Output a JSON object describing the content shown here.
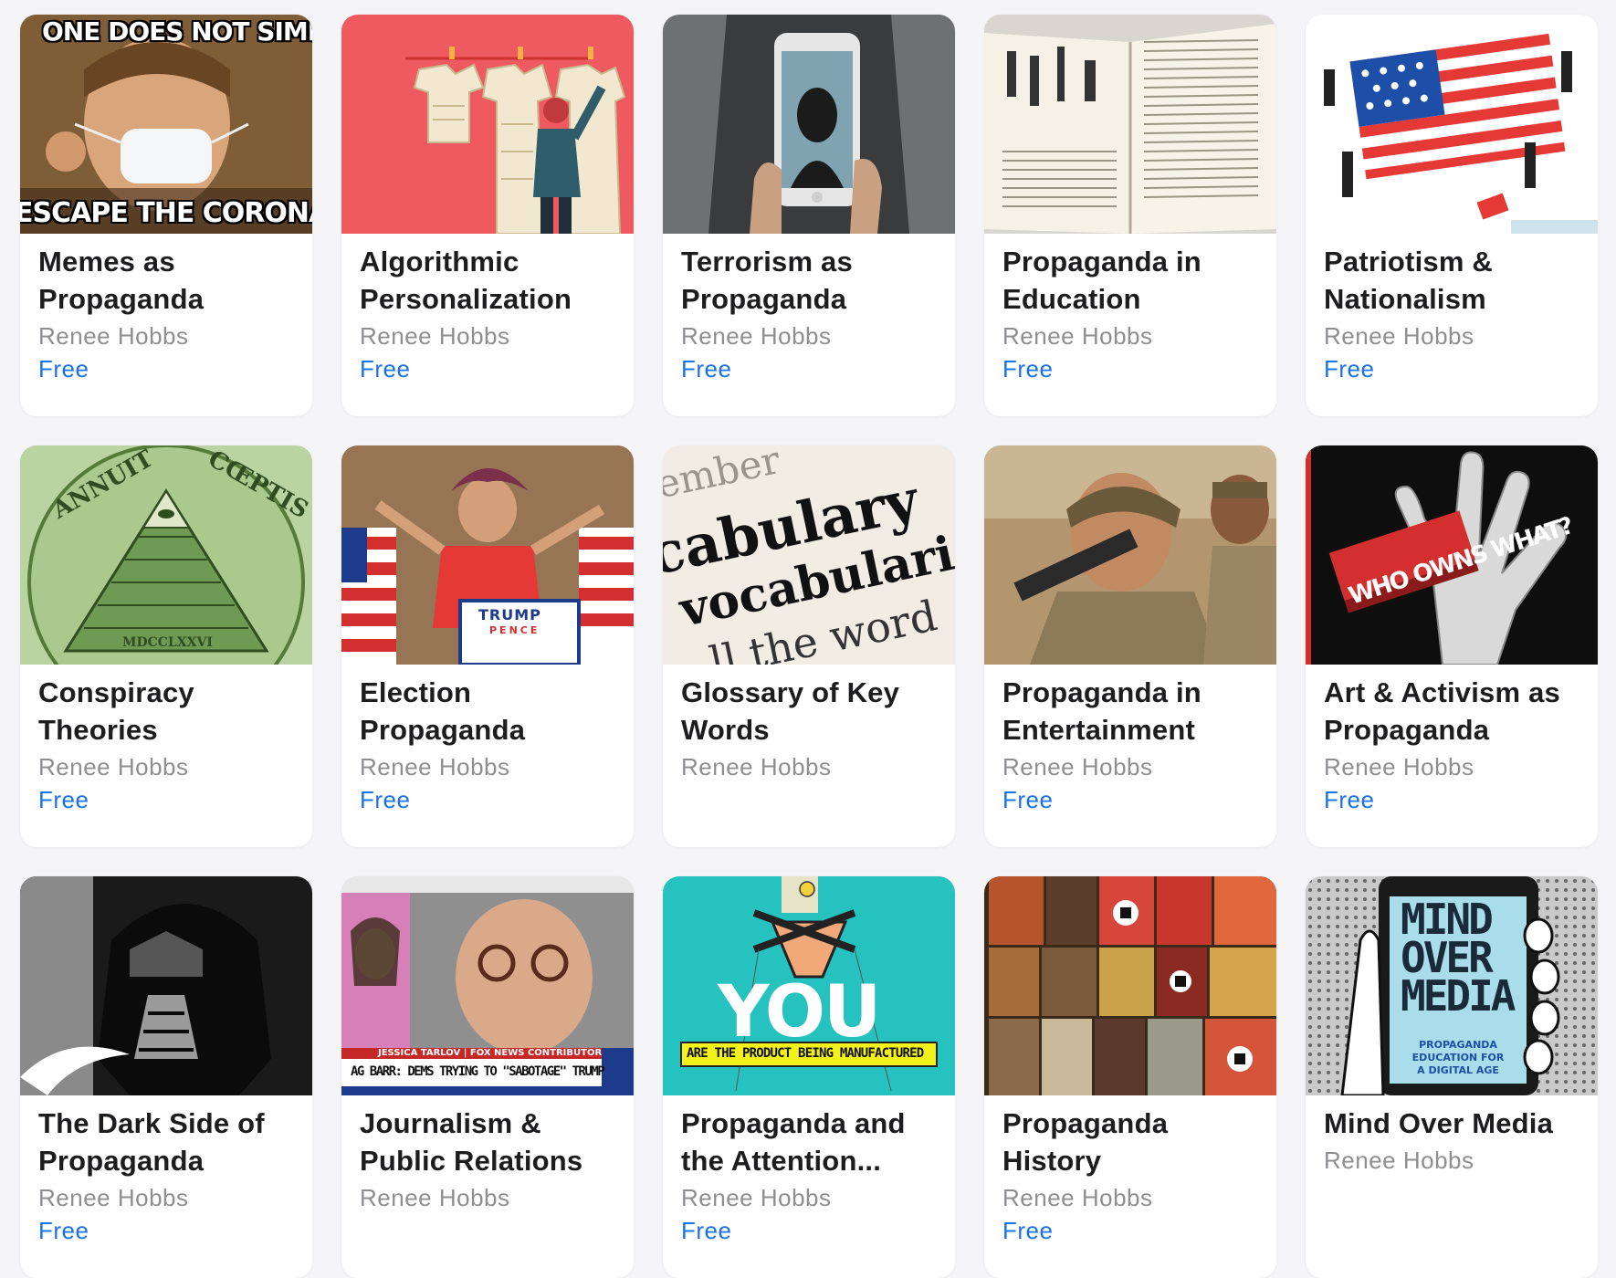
{
  "books": [
    {
      "title_line1": "Memes as",
      "title_line2": "Propaganda",
      "author": "Renee Hobbs",
      "price": "Free",
      "cover_top": "ONE DOES NOT SIMPLY",
      "cover_bottom": "ESCAPE THE CORONAVIRUS"
    },
    {
      "title_line1": "Algorithmic",
      "title_line2": "Personalization",
      "author": "Renee Hobbs",
      "price": "Free"
    },
    {
      "title_line1": "Terrorism as",
      "title_line2": "Propaganda",
      "author": "Renee Hobbs",
      "price": "Free"
    },
    {
      "title_line1": "Propaganda in",
      "title_line2": "Education",
      "author": "Renee Hobbs",
      "price": "Free"
    },
    {
      "title_line1": "Patriotism &",
      "title_line2": "Nationalism",
      "author": "Renee Hobbs",
      "price": "Free"
    },
    {
      "title_line1": "Conspiracy",
      "title_line2": "Theories",
      "author": "Renee Hobbs",
      "price": "Free",
      "cover_top_left": "ANNUIT",
      "cover_top_right": "CŒPTIS",
      "cover_bottom": "MDCCLXXVI"
    },
    {
      "title_line1": "Election",
      "title_line2": "Propaganda",
      "author": "Renee Hobbs",
      "price": "Free",
      "cover_sign1": "TRUMP",
      "cover_sign2": "PENCE"
    },
    {
      "title_line1": "Glossary of Key",
      "title_line2": "Words",
      "author": "Renee Hobbs",
      "price": "",
      "cover_l1": "iember",
      "cover_l2": "cabulary",
      "cover_l3": "vocabularie",
      "cover_l4": "ll the word"
    },
    {
      "title_line1": "Propaganda in",
      "title_line2": "Entertainment",
      "author": "Renee Hobbs",
      "price": "Free"
    },
    {
      "title_line1": "Art & Activism as",
      "title_line2": "Propaganda",
      "author": "Renee Hobbs",
      "price": "Free",
      "cover_sign": "WHO OWNS WHAT?"
    },
    {
      "title_line1": "The Dark Side of",
      "title_line2": "Propaganda",
      "author": "Renee Hobbs",
      "price": "Free"
    },
    {
      "title_line1": "Journalism &",
      "title_line2": "Public Relations",
      "author": "Renee Hobbs",
      "price": "",
      "cover_chyron1": "JESSICA TARLOV | FOX NEWS CONTRIBUTOR",
      "cover_chyron2": "AG BARR: DEMS TRYING TO \"SABOTAGE\" TRUMP"
    },
    {
      "title_line1": "Propaganda and",
      "title_line2": "the Attention...",
      "author": "Renee Hobbs",
      "price": "Free",
      "cover_big": "YOU",
      "cover_strip": "ARE THE PRODUCT BEING MANUFACTURED"
    },
    {
      "title_line1": "Propaganda",
      "title_line2": "History",
      "author": "Renee Hobbs",
      "price": "Free"
    },
    {
      "title_line1": "Mind Over Media",
      "title_line2": "",
      "author": "Renee Hobbs",
      "price": "",
      "cover_l1": "MIND",
      "cover_l2": "OVER",
      "cover_l3": "MEDIA",
      "cover_sub1": "PROPAGANDA",
      "cover_sub2": "EDUCATION FOR",
      "cover_sub3": "A DIGITAL AGE"
    }
  ],
  "colors": {
    "title": "#1d1d1f",
    "author": "#8e8e93",
    "price": "#1a73e8",
    "background": "#f5f5f7"
  }
}
